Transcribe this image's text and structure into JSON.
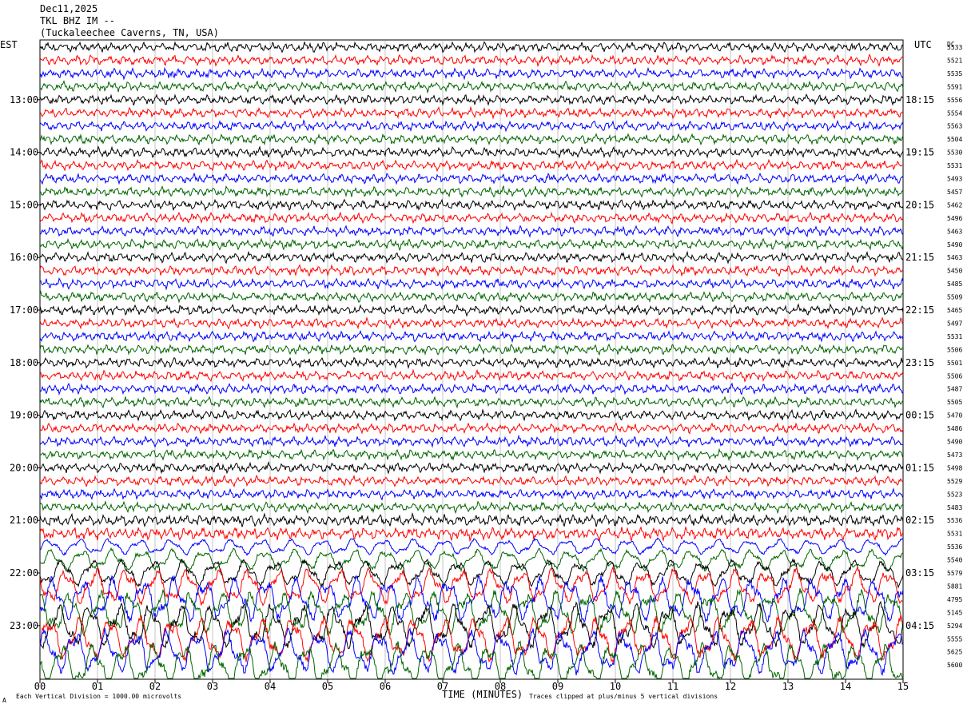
{
  "header": {
    "date": "Dec11,2025",
    "station": "TKL BHZ IM --",
    "location": "(Tuckaleechee Caverns, TN, USA)"
  },
  "labels": {
    "left_tz": "EST",
    "right_tz": "UTC",
    "dc_header": "DC",
    "x_title": "TIME (MINUTES)",
    "scale_note": "Each Vertical Division = 1000.00 microvolts",
    "clip_note": "Traces clipped at plus/minus 5 vertical divisions",
    "corner_mark": "A"
  },
  "colors": [
    "#000000",
    "#ff0000",
    "#0000ff",
    "#006400"
  ],
  "chart_data": {
    "type": "line",
    "title": "TKL BHZ IM --",
    "xlabel": "TIME (MINUTES)",
    "xlim": [
      0,
      15
    ],
    "x_ticks": [
      "00",
      "01",
      "02",
      "03",
      "04",
      "05",
      "06",
      "07",
      "08",
      "09",
      "10",
      "11",
      "12",
      "13",
      "14",
      "15"
    ],
    "left_time_labels": [
      {
        "row": 4,
        "label": "13:00"
      },
      {
        "row": 8,
        "label": "14:00"
      },
      {
        "row": 12,
        "label": "15:00"
      },
      {
        "row": 16,
        "label": "16:00"
      },
      {
        "row": 20,
        "label": "17:00"
      },
      {
        "row": 24,
        "label": "18:00"
      },
      {
        "row": 28,
        "label": "19:00"
      },
      {
        "row": 32,
        "label": "20:00"
      },
      {
        "row": 36,
        "label": "21:00"
      },
      {
        "row": 40,
        "label": "22:00"
      },
      {
        "row": 44,
        "label": "23:00"
      }
    ],
    "right_time_labels": [
      {
        "row": 4,
        "label": "18:15"
      },
      {
        "row": 8,
        "label": "19:15"
      },
      {
        "row": 12,
        "label": "20:15"
      },
      {
        "row": 16,
        "label": "21:15"
      },
      {
        "row": 20,
        "label": "22:15"
      },
      {
        "row": 24,
        "label": "23:15"
      },
      {
        "row": 28,
        "label": "00:15"
      },
      {
        "row": 32,
        "label": "01:15"
      },
      {
        "row": 36,
        "label": "02:15"
      },
      {
        "row": 40,
        "label": "03:15"
      },
      {
        "row": 44,
        "label": "04:15"
      }
    ],
    "dc_offsets": [
      "5533",
      "5521",
      "5535",
      "5591",
      "5556",
      "5554",
      "5563",
      "5504",
      "5530",
      "5531",
      "5493",
      "5457",
      "5462",
      "5496",
      "5463",
      "5490",
      "5463",
      "5450",
      "5485",
      "5509",
      "5465",
      "5497",
      "5531",
      "5506",
      "5501",
      "5506",
      "5487",
      "5505",
      "5470",
      "5486",
      "5490",
      "5473",
      "5498",
      "5529",
      "5523",
      "5483",
      "5536",
      "5531",
      "5536",
      "5540",
      "5579",
      "5881",
      "4795",
      "5145",
      "5294",
      "5555",
      "5625",
      "5600"
    ],
    "series_amplitude": [
      1,
      1,
      1,
      1,
      1,
      1,
      1,
      1,
      1,
      1,
      1,
      1,
      1,
      1,
      1,
      1,
      1,
      1,
      1,
      1,
      1,
      1,
      1,
      1,
      1,
      1,
      1,
      1,
      1,
      1,
      1,
      1,
      1,
      1,
      1,
      1,
      1.2,
      1.3,
      1.8,
      2.4,
      3,
      4,
      5,
      5,
      5,
      5,
      5,
      5
    ],
    "clipped_rows_from": 41
  }
}
